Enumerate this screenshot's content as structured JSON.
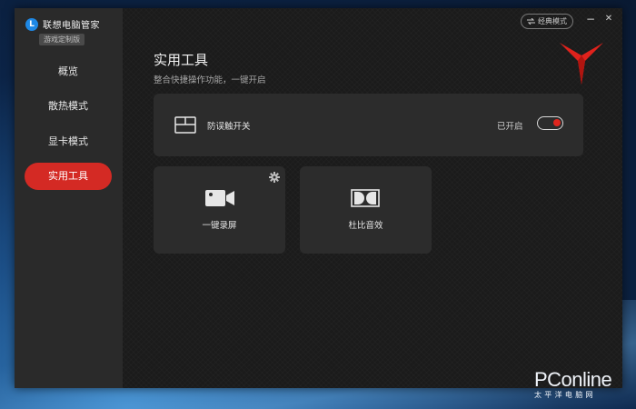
{
  "app": {
    "logo_letter": "L",
    "name": "联想电脑管家",
    "edition": "游戏定制版"
  },
  "sidebar": {
    "items": [
      {
        "label": "概览",
        "active": false
      },
      {
        "label": "散热模式",
        "active": false
      },
      {
        "label": "显卡模式",
        "active": false
      },
      {
        "label": "实用工具",
        "active": true
      }
    ]
  },
  "titlebar": {
    "mode_button_label": "经典模式",
    "minimize": "−",
    "close": "✕"
  },
  "page": {
    "title": "实用工具",
    "subtitle": "整合快捷操作功能，一键开启"
  },
  "tools": {
    "touchpad_lock": {
      "label": "防误触开关",
      "status": "已开启",
      "enabled": true
    },
    "tiles": [
      {
        "label": "一键录屏",
        "icon": "video-camera-icon",
        "has_settings": true
      },
      {
        "label": "杜比音效",
        "icon": "dolby-icon",
        "has_settings": false
      }
    ]
  },
  "colors": {
    "accent": "#d42a24",
    "toggle_knob": "#e0261e"
  },
  "watermark": {
    "main": "PConline",
    "sub": "太平洋电脑网"
  }
}
